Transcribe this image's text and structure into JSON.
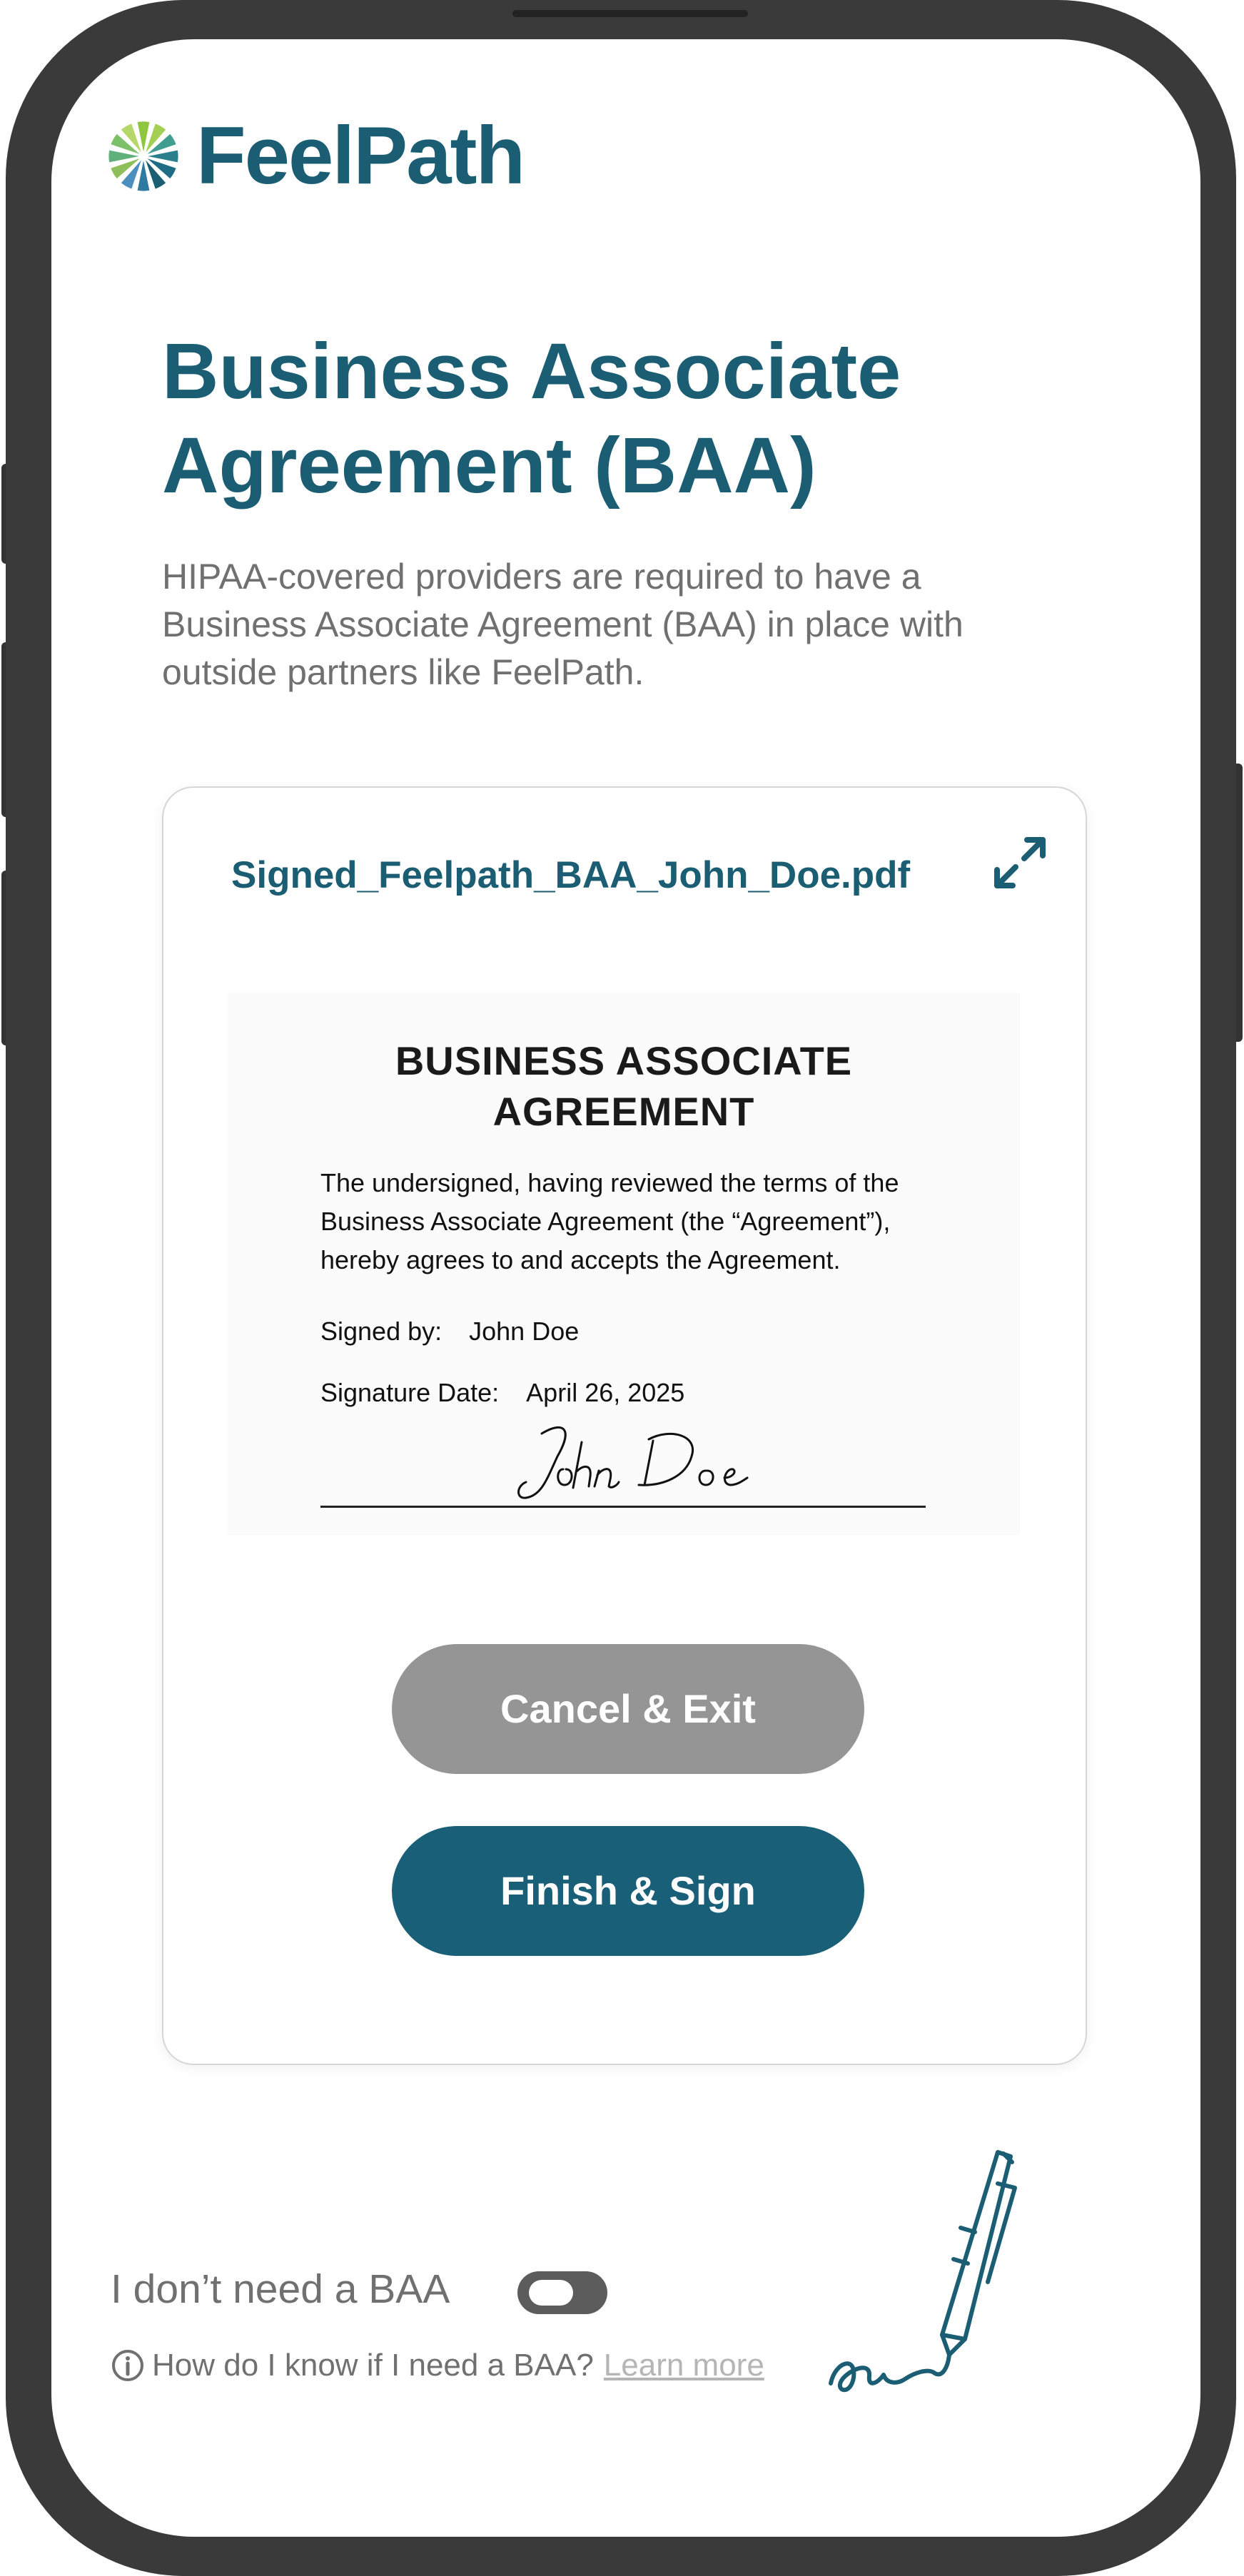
{
  "brand": {
    "name": "FeelPath",
    "color": "#1b5e73"
  },
  "page": {
    "title_line1": "Business Associate",
    "title_line2": "Agreement (BAA)",
    "description": "HIPAA-covered providers are required to have a Business Associate Agreement (BAA) in place with outside partners like FeelPath."
  },
  "document_card": {
    "file_name": "Signed_Feelpath_BAA_John_Doe.pdf",
    "expand_icon": "expand-arrows-icon",
    "preview": {
      "title_line1": "BUSINESS ASSOCIATE",
      "title_line2": "AGREEMENT",
      "body": "The undersigned, having reviewed the terms of the Business Associate Agreement (the “Agreement”), hereby agrees to and accepts the Agreement.",
      "signed_by_label": "Signed by:",
      "signed_by_value": "John Doe",
      "date_label": "Signature Date:",
      "date_value": "April 26, 2025",
      "signature": "John Doe"
    },
    "cancel_label": "Cancel & Exit",
    "finish_label": "Finish & Sign"
  },
  "no_baa": {
    "label": "I don’t need a BAA",
    "toggle_on": false,
    "help_text": "How do I know if I need a BAA?",
    "learn_more": "Learn more"
  },
  "colors": {
    "primary": "#195f77",
    "secondary_button": "#959595",
    "muted_text": "#707070",
    "frame": "#3a3a3a"
  }
}
